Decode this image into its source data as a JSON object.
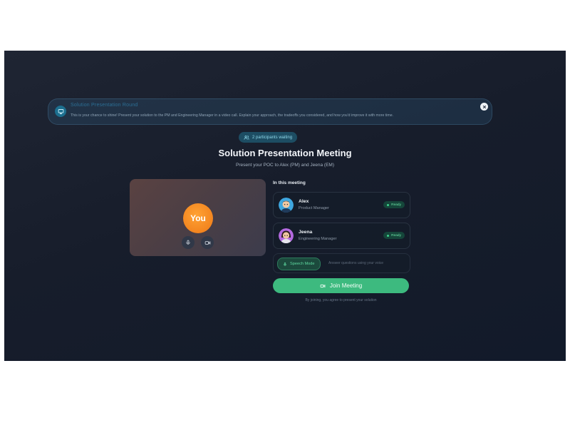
{
  "banner": {
    "title": "Solution Presentation Round",
    "text": "This is your chance to shine! Present your solution to the PM and Engineering Manager in a video call. Explain your approach, the tradeoffs you considered, and how you'd improve it with more time.",
    "icon": "monitor-icon",
    "close_icon": "close-icon"
  },
  "participants_pill": {
    "label": "2 participants waiting",
    "icon": "users-icon"
  },
  "meeting": {
    "title": "Solution Presentation Meeting",
    "subtitle": "Present your POC to Alex (PM) and Jeena (EM)"
  },
  "self_view": {
    "avatar_label": "You",
    "controls": [
      {
        "name": "microphone",
        "icon": "microphone-icon"
      },
      {
        "name": "camera",
        "icon": "video-camera-icon"
      }
    ]
  },
  "in_meeting": {
    "heading": "In this meeting",
    "participants": [
      {
        "name": "Alex",
        "role": "Product Manager",
        "status": "Ready"
      },
      {
        "name": "Jeena",
        "role": "Engineering Manager",
        "status": "Ready"
      }
    ]
  },
  "speech_mode": {
    "label": "Speech Mode",
    "hint": "Answer questions using your voice",
    "icon": "microphone-icon"
  },
  "join_button": {
    "label": "Join Meeting",
    "icon": "video-camera-icon"
  },
  "footer_note": "By joining, you agree to present your solution",
  "colors": {
    "background": "#171d2b",
    "accent_green": "#3dba7f",
    "you_orange": "#f3851f",
    "pill_teal": "#1d4d63"
  }
}
